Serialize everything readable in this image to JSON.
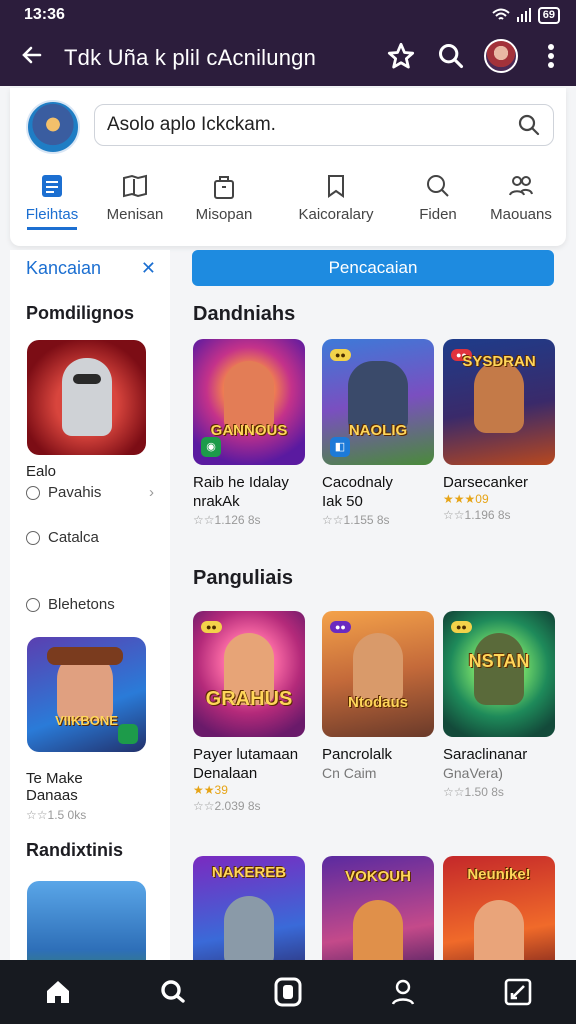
{
  "status": {
    "time": "13:36",
    "battery": "69"
  },
  "appbar": {
    "title": "Tdk Uña k plil cAcnilungn"
  },
  "search": {
    "value": "Asolo aplo Ickckam."
  },
  "categories": [
    {
      "label": "Fleihtas",
      "icon": "list-icon"
    },
    {
      "label": "Menisan",
      "icon": "book-icon"
    },
    {
      "label": "Misopan",
      "icon": "bag-icon"
    },
    {
      "label": "Kaicoralary",
      "icon": "bookmark-icon"
    },
    {
      "label": "Fiden",
      "icon": "search-icon"
    },
    {
      "label": "Maouans",
      "icon": "people-icon"
    }
  ],
  "side": {
    "header": "Kancaian",
    "section1": "Pomdilignos",
    "tile1_label": "Ealo",
    "options": [
      "Pavahis",
      "Catalca",
      "Blehetons"
    ],
    "tile2_text_line1": "Te Make",
    "tile2_text_line2": "Danaas",
    "tile2_rating": "☆☆1.5 0ks",
    "section2": "Randixtinis"
  },
  "main": {
    "button": "Pencacaian",
    "section1": "Dandniahs",
    "section2": "Panguliais",
    "row1": [
      {
        "line1": "Raib he Idalay",
        "line2": "nrakAk",
        "stars": "",
        "meta": "☆☆1.126 8s",
        "logo": "GANNOUS"
      },
      {
        "line1": "Cacodnaly",
        "line2": "Iak 50",
        "stars": "",
        "meta": "☆☆1.155 8s",
        "logo": "NAOLIG"
      },
      {
        "line1": "Darsecanker",
        "line2": "",
        "stars": "★★★09",
        "meta": "☆☆1.196 8s",
        "logo": "SYSDRAN"
      }
    ],
    "row2": [
      {
        "line1": "Payer lutamaan",
        "line2": "Denalaan",
        "stars": "★★39",
        "meta": "☆☆2.039 8s",
        "logo": "GRAHUS"
      },
      {
        "line1": "Pancrolalk",
        "line2": "Cn Caim",
        "stars": "",
        "meta": "",
        "logo": "Ntodaus"
      },
      {
        "line1": "Saraclinanar",
        "line2": "GnaVera)",
        "stars": "",
        "meta": "☆☆1.50 8s",
        "logo": "NSTAN"
      }
    ],
    "row3": [
      {
        "logo": "NAKEREB"
      },
      {
        "logo": "VOKOUH"
      },
      {
        "logo": "Neunike!"
      }
    ]
  },
  "bottom_nav": [
    "home-icon",
    "search-icon",
    "library-icon",
    "profile-icon",
    "edit-icon"
  ],
  "colors": {
    "appbar": "#2c1d3c",
    "accent": "#1c6fd1",
    "button": "#1e8be0",
    "nav": "#171a20"
  }
}
